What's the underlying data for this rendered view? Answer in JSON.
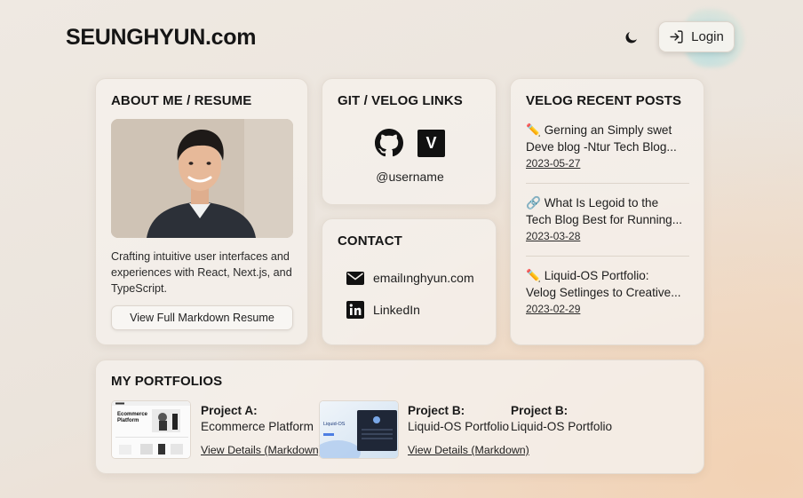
{
  "header": {
    "site_title": "SEUNGHYUN.com",
    "login_label": "Login"
  },
  "about": {
    "title": "ABOUT ME / RESUME",
    "description": "Crafting intuitive user interfaces and experiences with React, Next.js, and TypeScript.",
    "resume_button": "View Full Markdown Resume"
  },
  "git": {
    "title": "GIT / VELOG LINKS",
    "velog_letter": "V",
    "username": "@username"
  },
  "contact": {
    "title": "CONTACT",
    "email": "emailınghyun.com",
    "linkedin": "LinkedIn"
  },
  "posts": {
    "title": "VELOG RECENT POSTS",
    "items": [
      {
        "icon": "pencil-icon",
        "title_line1": "Gerning an Simply swet",
        "title_line2": "Deve blog -Ntur Tech Blog...",
        "date": "2023-05-27"
      },
      {
        "icon": "link-icon",
        "title_line1": "What Is Legoid to the",
        "title_line2": "Tech Blog Best for Running...",
        "date": "2023-03-28"
      },
      {
        "icon": "pencil-icon",
        "title_line1": "Liquid-OS Portfolio:",
        "title_line2": "Velog Setlinges to Creative...",
        "date": "2023-02-29"
      }
    ]
  },
  "portfolios": {
    "title": "MY PORTFOLIOS",
    "items": [
      {
        "name": "Project A:",
        "description": "Ecommerce Platform",
        "link": "View Details (Markdown)",
        "thumb_heading": "Ecommerce Platform"
      },
      {
        "name": "Project B:",
        "description": "Liquid-OS Portfolio",
        "link": "View Details (Markdown)",
        "thumb_heading": "Liquid-OS"
      },
      {
        "name": "Project B:",
        "description": "Liquid-OS Portfolio"
      }
    ]
  },
  "colors": {
    "accent_blob": "#aadce1",
    "card_bg": "#f4f0eb"
  }
}
